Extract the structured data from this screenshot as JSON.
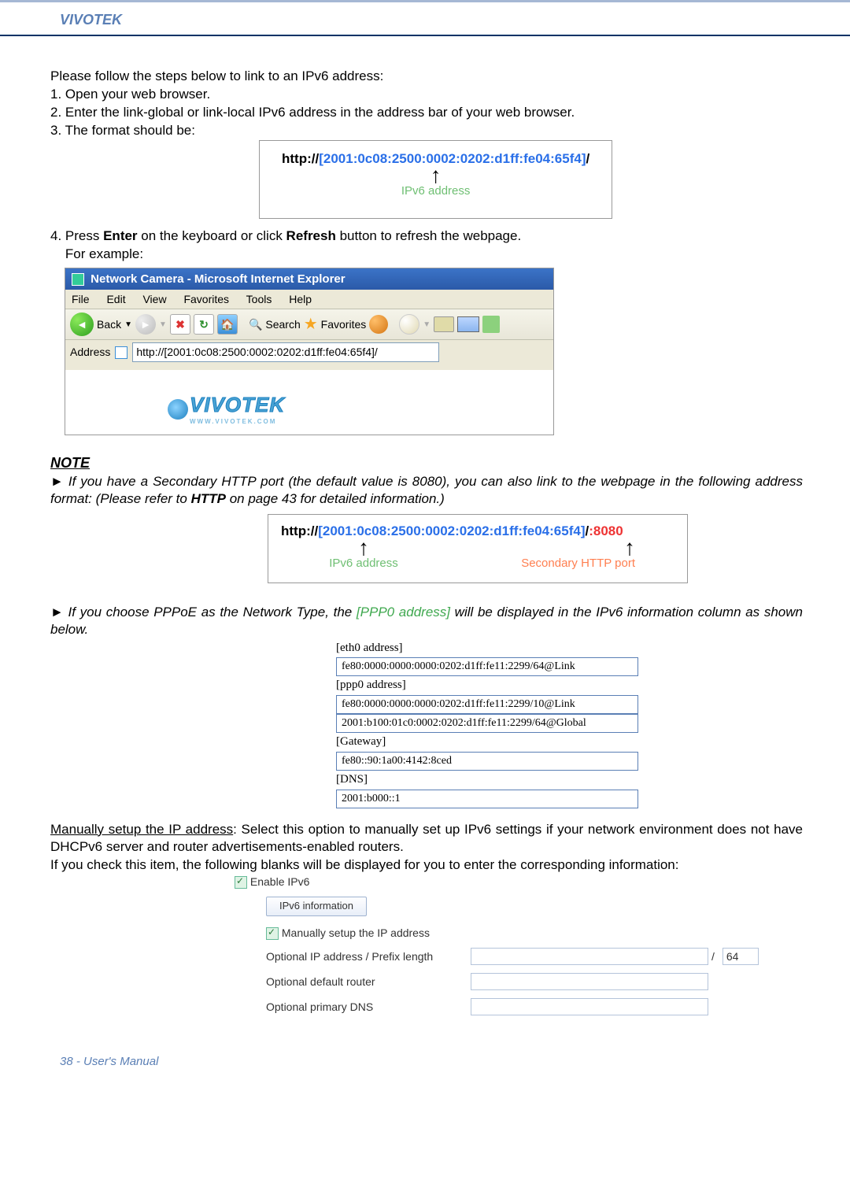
{
  "header": {
    "brand": "VIVOTEK"
  },
  "steps": {
    "intro": "Please follow the steps below to link to an IPv6 address:",
    "s1": "1. Open your web browser.",
    "s2": "2. Enter the link-global or link-local IPv6 address in the address bar of your web browser.",
    "s3": "3. The format should be:"
  },
  "url_example": {
    "prefix": "http://",
    "open": "[",
    "ipv6": "2001:0c08:2500:0002:0202:d1ff:fe04:65f4",
    "close": "]",
    "suffix": "/",
    "label": "IPv6 address"
  },
  "step4": {
    "line1_pre": "4. Press ",
    "bold1": "Enter",
    "mid": " on the keyboard or click ",
    "bold2": "Refresh",
    "post": " button to refresh the webpage.",
    "line2": "    For example:"
  },
  "ie": {
    "title": "Network Camera - Microsoft Internet Explorer",
    "menu": {
      "file": "File",
      "edit": "Edit",
      "view": "View",
      "favorites": "Favorites",
      "tools": "Tools",
      "help": "Help"
    },
    "toolbar": {
      "back": "Back",
      "search": "Search",
      "favorites": "Favorites"
    },
    "address_label": "Address",
    "address_value": "http://[2001:0c08:2500:0002:0202:d1ff:fe04:65f4]/",
    "logo_text": "VIVOTEK",
    "logo_sub": "WWW.VIVOTEK.COM"
  },
  "note": {
    "heading": "NOTE",
    "p1_pre": "► If you have a Secondary HTTP port (the default value is 8080), you can also link to the webpage in the following address format: (Please refer to ",
    "p1_bold": "HTTP",
    "p1_post": " on page 43 for detailed information.)",
    "url2_port": ":8080",
    "label_port": "Secondary HTTP port",
    "p2_pre": "► If you choose PPPoE as the Network Type, the ",
    "p2_green": "[PPP0 address]",
    "p2_post": " will be displayed in the IPv6 information column as shown below."
  },
  "ipv6_info": {
    "eth0": "[eth0 address]",
    "eth0_v": "fe80:0000:0000:0000:0202:d1ff:fe11:2299/64@Link",
    "ppp0": "[ppp0 address]",
    "ppp0_v1": "fe80:0000:0000:0000:0202:d1ff:fe11:2299/10@Link",
    "ppp0_v2": "2001:b100:01c0:0002:0202:d1ff:fe11:2299/64@Global",
    "gateway": "[Gateway]",
    "gateway_v": "fe80::90:1a00:4142:8ced",
    "dns": "[DNS]",
    "dns_v": "2001:b000::1"
  },
  "manual": {
    "title_u": "Manually setup the IP address",
    "title_rest": ": Select this option to manually set up IPv6 settings if your network environment does not have DHCPv6 server and router advertisements-enabled routers.",
    "line2": "If you check this item, the following blanks will be displayed for you to enter the corresponding information:",
    "enable": "Enable IPv6",
    "info_btn": "IPv6 information",
    "chk_manual": "Manually setup the IP address",
    "row1": "Optional IP address / Prefix length",
    "row1_suffix": "64",
    "row2": "Optional default router",
    "row3": "Optional primary DNS"
  },
  "footer": "38 - User's Manual"
}
